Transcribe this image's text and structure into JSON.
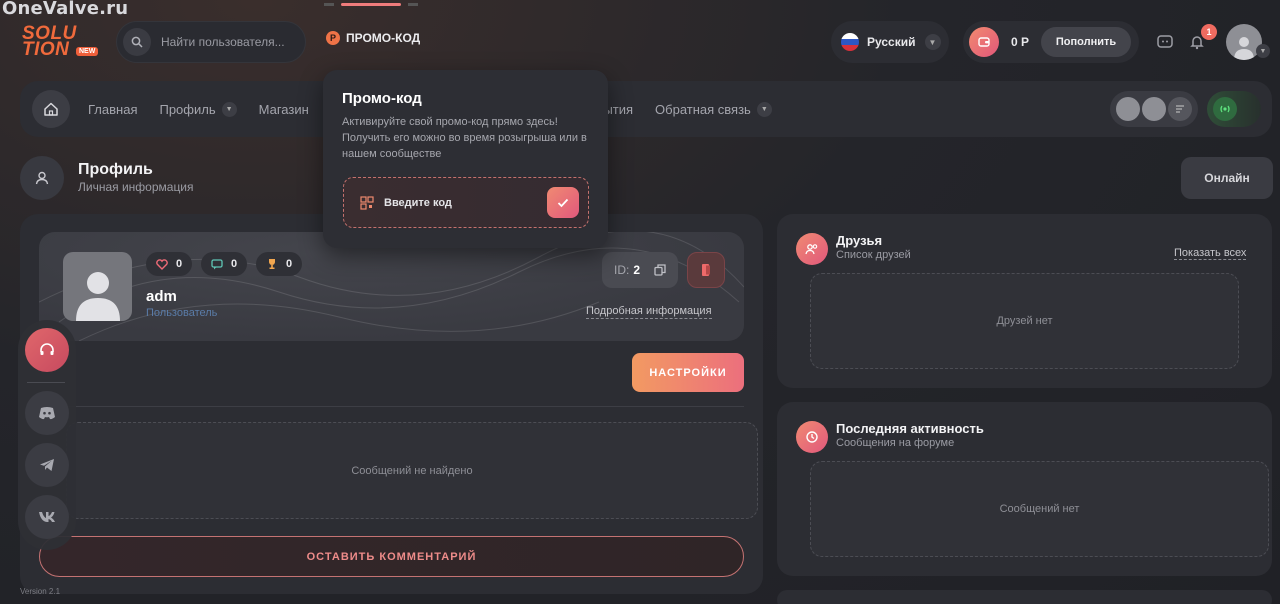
{
  "watermark": "OneValve.ru",
  "logo": {
    "line1": "SOLU",
    "line2": "TION",
    "badge": "NEW"
  },
  "search": {
    "placeholder": "Найти пользователя..."
  },
  "promo_tab": {
    "coin": "P",
    "label": "ПРОМО-КОД"
  },
  "language": {
    "label": "Русский"
  },
  "balance": {
    "amount": "0 Р",
    "topup_label": "Пополнить"
  },
  "notifications": {
    "count": "1"
  },
  "nav": {
    "items": [
      {
        "label": "Главная",
        "dropdown": false
      },
      {
        "label": "Профиль",
        "dropdown": true
      },
      {
        "label": "Магазин",
        "dropdown": false
      },
      {
        "label": "обытия",
        "dropdown": false
      },
      {
        "label": "Обратная связь",
        "dropdown": true
      }
    ]
  },
  "page_header": {
    "title": "Профиль",
    "subtitle": "Личная информация",
    "status": "Онлайн"
  },
  "profile": {
    "likes": "0",
    "comments": "0",
    "trophies": "0",
    "name": "adm",
    "role": "Пользователь",
    "id_label": "ID:",
    "id_value": "2",
    "details_link": "Подробная информация"
  },
  "actions": {
    "settings_label": "НАСТРОЙКИ",
    "comment_label": "ОСТАВИТЬ КОММЕНТАРИЙ"
  },
  "messages_empty": "Сообщений не найдено",
  "version": "Version 2.1",
  "friends": {
    "title": "Друзья",
    "subtitle": "Список друзей",
    "show_all": "Показать всех",
    "empty": "Друзей нет"
  },
  "activity": {
    "title": "Последняя активность",
    "subtitle": "Сообщения на форуме",
    "empty": "Сообщений нет"
  },
  "promo_popup": {
    "title": "Промо-код",
    "description": "Активируйте свой промо-код прямо здесь! Получить его можно во время розыгрыша или в нашем сообществе",
    "input_placeholder": "Введите код"
  },
  "colors": {
    "accent": "#ef7347",
    "gradient_from": "#f29a62",
    "gradient_to": "#ec6f7d",
    "panel": "#2c2d33"
  }
}
